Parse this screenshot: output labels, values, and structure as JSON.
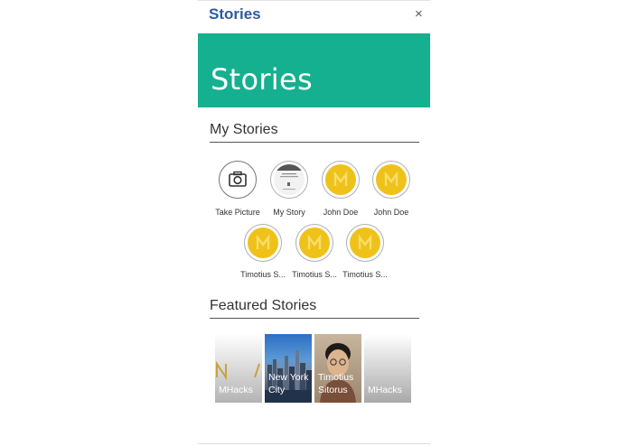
{
  "window": {
    "title": "Stories",
    "close_glyph": "×"
  },
  "banner": {
    "title": "Stories",
    "color": "#15b08f"
  },
  "my_stories": {
    "heading": "My Stories",
    "items": [
      {
        "label": "Take Picture",
        "icon": "camera-icon"
      },
      {
        "label": "My Story",
        "icon": "story-thumbnail"
      },
      {
        "label": "John Doe",
        "icon": "mhacks-logo-avatar"
      },
      {
        "label": "John Doe",
        "icon": "mhacks-logo-avatar"
      },
      {
        "label": "Timotius S...",
        "icon": "mhacks-logo-avatar"
      },
      {
        "label": "Timotius S...",
        "icon": "mhacks-logo-avatar"
      },
      {
        "label": "Timotius S...",
        "icon": "mhacks-logo-avatar"
      }
    ]
  },
  "featured_stories": {
    "heading": "Featured Stories",
    "items": [
      {
        "label": "MHacks"
      },
      {
        "label": "New York City"
      },
      {
        "label": "Timotius Sitorus"
      },
      {
        "label": "MHacks"
      }
    ]
  },
  "colors": {
    "accent": "#15b08f",
    "title_blue": "#2f5a9e",
    "avatar_gold": "#efc21a"
  }
}
